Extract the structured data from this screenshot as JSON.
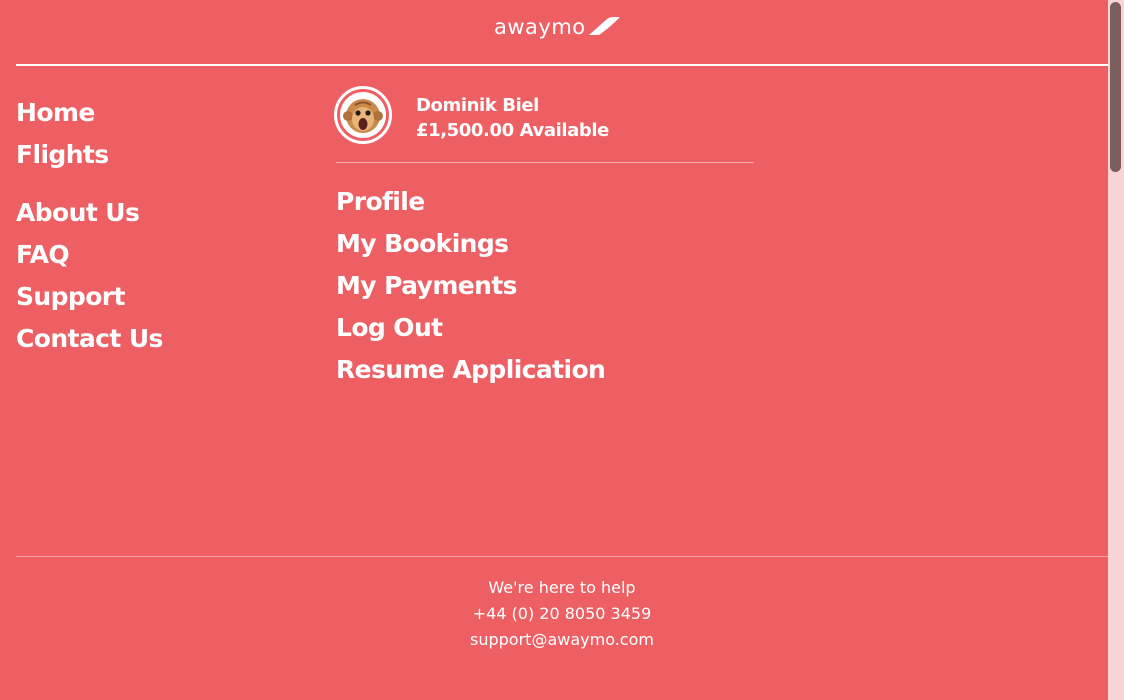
{
  "header": {
    "logo_text": "awaymo",
    "close_label": "×"
  },
  "nav_main": [
    {
      "label": "Home"
    },
    {
      "label": "Flights"
    }
  ],
  "nav_info": [
    {
      "label": "About Us"
    },
    {
      "label": "FAQ"
    },
    {
      "label": "Support"
    },
    {
      "label": "Contact Us"
    }
  ],
  "account": {
    "user_name": "Dominik Biel",
    "balance": "£1,500.00 Available",
    "links": [
      {
        "label": "Profile"
      },
      {
        "label": "My Bookings"
      },
      {
        "label": "My Payments"
      },
      {
        "label": "Log Out"
      },
      {
        "label": "Resume Application"
      }
    ]
  },
  "footer": {
    "tagline": "We're here to help",
    "phone": "+44 (0) 20 8050 3459",
    "email": "support@awaymo.com"
  },
  "colors": {
    "background": "#ee5f63",
    "text": "#ffffff",
    "scrollbar_track": "#f9d4d4",
    "scrollbar_thumb": "#7a5d5d"
  },
  "icons": {
    "avatar": "monkey-face-icon",
    "logo_mark": "wing-swoosh-icon",
    "close": "close-icon"
  }
}
